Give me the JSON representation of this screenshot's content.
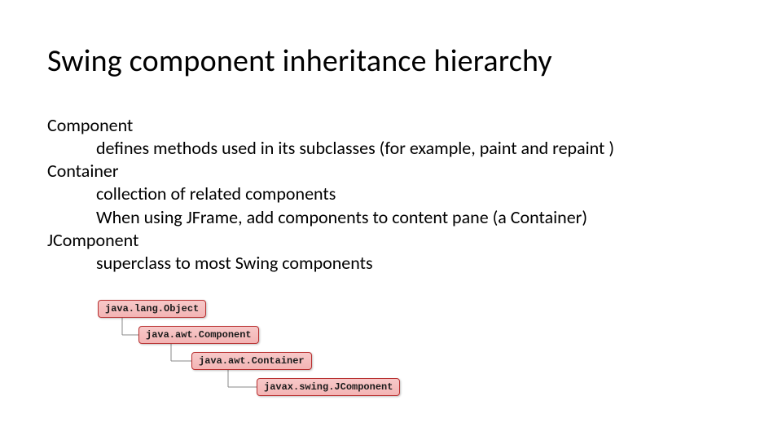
{
  "title": "Swing component inheritance hierarchy",
  "body": {
    "term1": "Component",
    "desc1": "defines methods used in its subclasses (for example, paint and repaint )",
    "term2": "Container",
    "desc2a": "collection of related components",
    "desc2b": "When using  JFrame, add components to content pane (a Container)",
    "term3": "JComponent",
    "desc3": "superclass to most Swing components"
  },
  "diagram": {
    "nodes": [
      "java.lang.Object",
      "java.awt.Component",
      "java.awt.Container",
      "javax.swing.JComponent"
    ]
  }
}
